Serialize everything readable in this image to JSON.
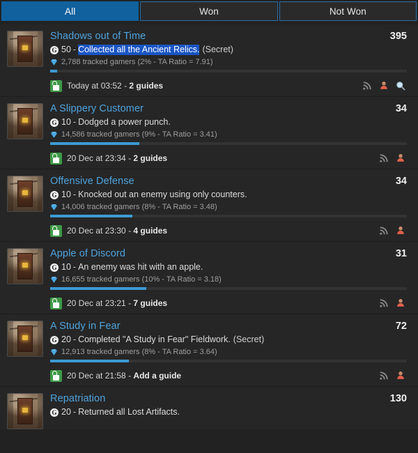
{
  "tabs": [
    {
      "label": "All",
      "active": true
    },
    {
      "label": "Won",
      "active": false
    },
    {
      "label": "Not Won",
      "active": false
    }
  ],
  "colors": {
    "page_background": "#222222",
    "row_background": "#262626",
    "tab_active_background": "#10619e",
    "tab_border": "#2e6ea5",
    "title_link": "#4ea3dd",
    "progress_fill": "#3d9ad4",
    "lock_unlocked": "#3f9a48",
    "selection_highlight": "#1a55c4",
    "stats_text": "#9f9f9f"
  },
  "icons": {
    "gamerscore": "G",
    "gem": "gem-icon",
    "lock": "unlocked-padlock-icon",
    "rss": "rss-icon",
    "person": "person-icon",
    "search": "magnifier-icon"
  },
  "achievements": [
    {
      "title": "Shadows out of Time",
      "score": "395",
      "gamerscore": "50",
      "separator": "-",
      "description": "Collected all the Ancient Relics.",
      "description_selected": true,
      "secret": "(Secret)",
      "stats": "2,788 tracked gamers (2% - TA Ratio = 7.91)",
      "progress_percent": 2,
      "unlock_date": "Today at 03:52",
      "guides": "2 guides",
      "actions": [
        "rss-icon",
        "person-icon",
        "magnifier-icon"
      ]
    },
    {
      "title": "A Slippery Customer",
      "score": "34",
      "gamerscore": "10",
      "separator": "-",
      "description": "Dodged a power punch.",
      "description_selected": false,
      "secret": "",
      "stats": "14,586 tracked gamers (9% - TA Ratio = 3.41)",
      "progress_percent": 25,
      "unlock_date": "20 Dec at 23:34",
      "guides": "2 guides",
      "actions": [
        "rss-icon",
        "person-icon"
      ]
    },
    {
      "title": "Offensive Defense",
      "score": "34",
      "gamerscore": "10",
      "separator": "-",
      "description": "Knocked out an enemy using only counters.",
      "description_selected": false,
      "secret": "",
      "stats": "14,006 tracked gamers (8% - TA Ratio = 3.48)",
      "progress_percent": 23,
      "unlock_date": "20 Dec at 23:30",
      "guides": "4 guides",
      "actions": [
        "rss-icon",
        "person-icon"
      ]
    },
    {
      "title": "Apple of Discord",
      "score": "31",
      "gamerscore": "10",
      "separator": "-",
      "description": "An enemy was hit with an apple.",
      "description_selected": false,
      "secret": "",
      "stats": "16,655 tracked gamers (10% - TA Ratio = 3.18)",
      "progress_percent": 27,
      "unlock_date": "20 Dec at 23:21",
      "guides": "7 guides",
      "actions": [
        "rss-icon",
        "person-icon"
      ]
    },
    {
      "title": "A Study in Fear",
      "score": "72",
      "gamerscore": "20",
      "separator": "-",
      "description": "Completed \"A Study in Fear\" Fieldwork.",
      "description_selected": false,
      "secret": "(Secret)",
      "stats": "12,913 tracked gamers (8% - TA Ratio = 3.64)",
      "progress_percent": 22,
      "unlock_date": "20 Dec at 21:58",
      "guides": "Add a guide",
      "actions": [
        "rss-icon",
        "person-icon"
      ]
    },
    {
      "title": "Repatriation",
      "score": "130",
      "gamerscore": "20",
      "separator": "-",
      "description": "Returned all Lost Artifacts.",
      "description_selected": false,
      "secret": "",
      "stats": "",
      "progress_percent": 0,
      "unlock_date": "",
      "guides": "",
      "actions": []
    }
  ]
}
